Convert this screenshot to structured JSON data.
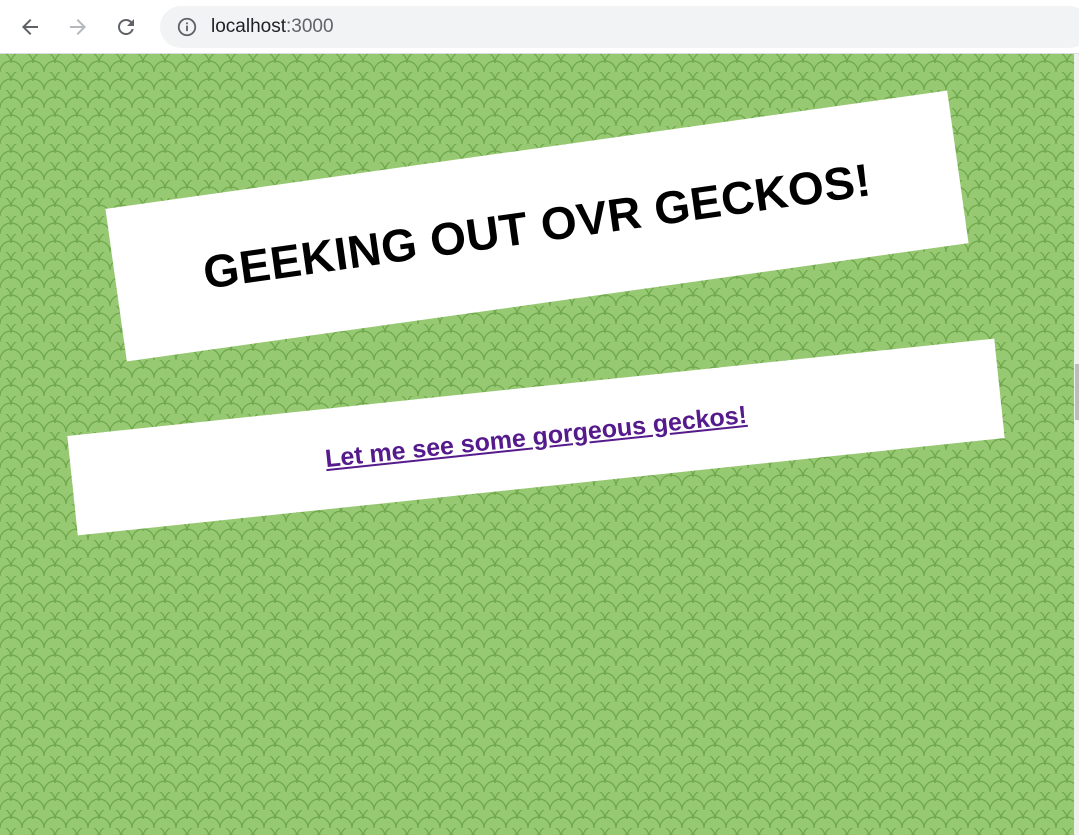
{
  "browser": {
    "url_host": "localhost",
    "url_port": ":3000",
    "back_icon": "arrow-left-icon",
    "forward_icon": "arrow-right-icon",
    "reload_icon": "reload-icon",
    "info_icon": "info-icon"
  },
  "page": {
    "title": "GEEKING OUT OVR GECKOS!",
    "link_text": "Let me see some gorgeous geckos!"
  },
  "colors": {
    "background": "#97c972",
    "pattern_stroke": "#6fa84c",
    "link": "#551a8b",
    "title": "#000000"
  }
}
